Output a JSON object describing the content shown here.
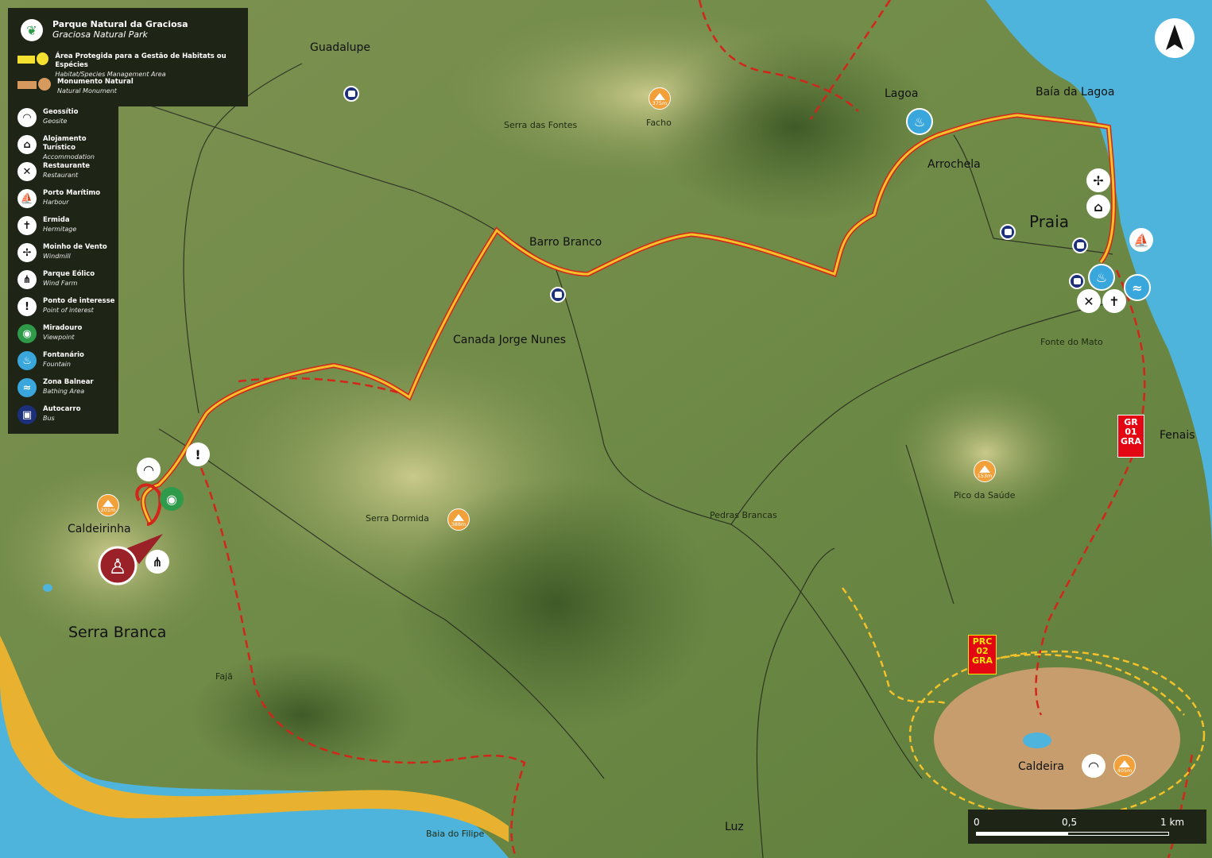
{
  "legend": {
    "park_title": "Parque Natural da Graciosa",
    "park_subtitle": "Graciosa Natural Park",
    "areas": [
      {
        "pt": "Área Protegida para a Gestão de Habitats ou Espécies",
        "en": "Habitat/Species Management Area",
        "color": "#f3e030"
      },
      {
        "pt": "Monumento Natural",
        "en": "Natural Monument",
        "color": "#d79a5e"
      }
    ],
    "items": [
      {
        "icon": "geosite-icon",
        "glyph": "◠",
        "pt": "Geossítio",
        "en": "Geosite",
        "bg": "#ffffff"
      },
      {
        "icon": "accommodation-icon",
        "glyph": "⌂",
        "pt": "Alojamento Turístico",
        "en": "Accommodation",
        "bg": "#ffffff"
      },
      {
        "icon": "restaurant-icon",
        "glyph": "✕",
        "pt": "Restaurante",
        "en": "Restaurant",
        "bg": "#ffffff"
      },
      {
        "icon": "harbour-icon",
        "glyph": "⛵",
        "pt": "Porto Marítimo",
        "en": "Harbour",
        "bg": "#ffffff"
      },
      {
        "icon": "hermitage-icon",
        "glyph": "✝",
        "pt": "Ermida",
        "en": "Hermitage",
        "bg": "#ffffff"
      },
      {
        "icon": "windmill-icon",
        "glyph": "✢",
        "pt": "Moinho de Vento",
        "en": "Windmill",
        "bg": "#ffffff"
      },
      {
        "icon": "wind-farm-icon",
        "glyph": "⋔",
        "pt": "Parque Eólico",
        "en": "Wind Farm",
        "bg": "#ffffff"
      },
      {
        "icon": "point-of-interest-icon",
        "glyph": "!",
        "pt": "Ponto de interesse",
        "en": "Point of interest",
        "bg": "#ffffff"
      },
      {
        "icon": "viewpoint-icon",
        "glyph": "◉",
        "pt": "Miradouro",
        "en": "Viewpoint",
        "bg": "#2e9a4a"
      },
      {
        "icon": "fountain-icon",
        "glyph": "♨",
        "pt": "Fontanário",
        "en": "Fountain",
        "bg": "#3aa7dc"
      },
      {
        "icon": "bathing-area-icon",
        "glyph": "≈",
        "pt": "Zona Balnear",
        "en": "Bathing Area",
        "bg": "#3aa7dc"
      },
      {
        "icon": "bus-icon",
        "glyph": "▣",
        "pt": "Autocarro",
        "en": "Bus",
        "bg": "#1c2f7a"
      }
    ]
  },
  "places": {
    "guadalupe": "Guadalupe",
    "serra_das_fontes": "Serra das Fontes",
    "facho": "Facho",
    "lagoa": "Lagoa",
    "baia_da_lagoa": "Baía da Lagoa",
    "arrochela": "Arrochela",
    "praia": "Praia",
    "barro_branco": "Barro Branco",
    "canada_jorge_nunes": "Canada Jorge Nunes",
    "fonte_do_mato": "Fonte do Mato",
    "fenais": "Fenais",
    "pico_da_saude": "Pico da Saúde",
    "serra_dormida": "Serra Dormida",
    "pedras_brancas": "Pedras Brancas",
    "caldeirinha": "Caldeirinha",
    "serra_branca": "Serra Branca",
    "faja": "Fajã",
    "caldeira": "Caldeira",
    "luz": "Luz",
    "baia_do_filipe": "Baia do Filipe"
  },
  "peaks": {
    "facho": "375m",
    "caldeirinha": "201m",
    "serra_dormida": "388m",
    "pico_da_saude": "153m",
    "caldeira": "405m"
  },
  "trails": {
    "gr": [
      "GR",
      "01",
      "GRA"
    ],
    "prc": [
      "PRC",
      "02",
      "GRA"
    ]
  },
  "scale": {
    "zero": "0",
    "half": "0,5",
    "one": "1 km"
  },
  "colors": {
    "trail_main": "#f3c12a",
    "trail_edge": "#d2261a",
    "sea": "#4fb4dc",
    "coast_cliff": "#e8b230",
    "monument": "#d3a073"
  }
}
